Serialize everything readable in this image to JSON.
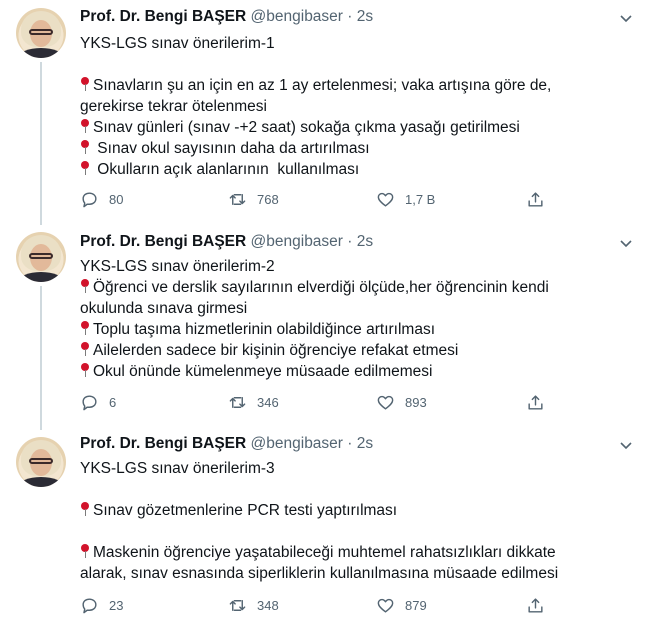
{
  "author": {
    "name": "Prof. Dr. Bengi BAŞER",
    "handle": "@bengibaser",
    "time": "2s"
  },
  "tweets": [
    {
      "lines": [
        {
          "pin": false,
          "text": "YKS-LGS sınav önerilerim-1"
        },
        {
          "pin": false,
          "text": ""
        },
        {
          "pin": true,
          "text": "Sınavların şu an için en az 1 ay ertelenmesi; vaka artışına göre de,"
        },
        {
          "pin": false,
          "text": "gerekirse tekrar ötelenmesi"
        },
        {
          "pin": true,
          "text": "Sınav günleri (sınav -+2 saat) sokağa çıkma yasağı getirilmesi"
        },
        {
          "pin": true,
          "text": " Sınav okul sayısının daha da artırılması"
        },
        {
          "pin": true,
          "text": " Okulların açık alanlarının  kullanılması"
        }
      ],
      "replies": "80",
      "retweets": "768",
      "likes": "1,7 B"
    },
    {
      "lines": [
        {
          "pin": false,
          "text": "YKS-LGS sınav önerilerim-2"
        },
        {
          "pin": true,
          "text": "Öğrenci ve derslik sayılarının elverdiği ölçüde,her öğrencinin kendi"
        },
        {
          "pin": false,
          "text": "okulunda sınava girmesi"
        },
        {
          "pin": true,
          "text": "Toplu taşıma hizmetlerinin olabildiğince artırılması"
        },
        {
          "pin": true,
          "text": "Ailelerden sadece bir kişinin öğrenciye refakat etmesi"
        },
        {
          "pin": true,
          "text": "Okul önünde kümelenmeye müsaade edilmemesi"
        }
      ],
      "replies": "6",
      "retweets": "346",
      "likes": "893"
    },
    {
      "lines": [
        {
          "pin": false,
          "text": "YKS-LGS sınav önerilerim-3"
        },
        {
          "pin": false,
          "text": ""
        },
        {
          "pin": true,
          "text": "Sınav gözetmenlerine PCR testi yaptırılması"
        },
        {
          "pin": false,
          "text": ""
        },
        {
          "pin": true,
          "text": "Maskenin öğrenciye yaşatabileceği muhtemel rahatsızlıkları dikkate"
        },
        {
          "pin": false,
          "text": "alarak, sınav esnasında siperliklerin kullanılmasına müsaade edilmesi"
        }
      ],
      "replies": "23",
      "retweets": "348",
      "likes": "879"
    }
  ],
  "icons": {
    "reply": "reply-icon",
    "retweet": "retweet-icon",
    "like": "heart-icon",
    "share": "share-icon",
    "more": "chevron-down-icon"
  },
  "colors": {
    "text": "#0f1419",
    "secondary": "#536471",
    "thread": "#cfd9de",
    "pin": "#d2132b"
  }
}
